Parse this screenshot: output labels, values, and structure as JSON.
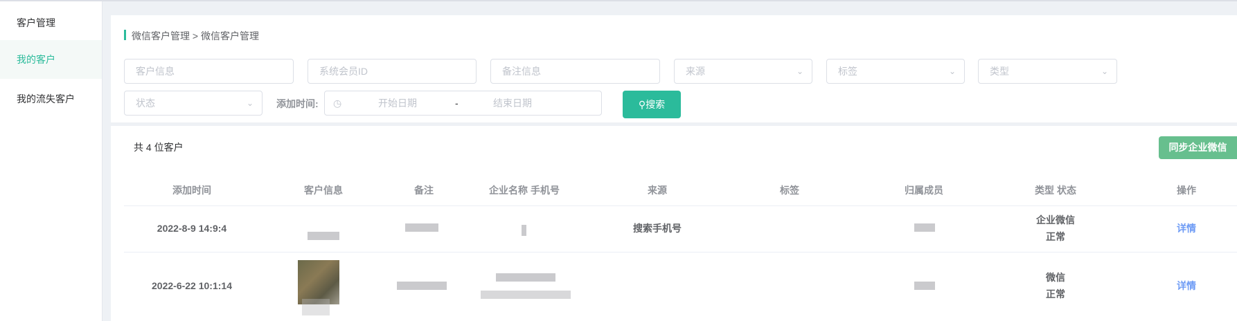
{
  "sidebar": {
    "items": [
      {
        "label": "客户管理"
      },
      {
        "label": "我的客户",
        "active": true
      },
      {
        "label": "我的流失客户"
      }
    ]
  },
  "breadcrumb": "微信客户管理 > 微信客户管理",
  "filters": {
    "customer_info": "客户信息",
    "member_id": "系统会员ID",
    "remark": "备注信息",
    "source": "来源",
    "tag": "标签",
    "type": "类型",
    "status": "状态",
    "add_time_label": "添加时间:",
    "start_date": "开始日期",
    "date_sep": "-",
    "end_date": "结束日期",
    "search_label": "搜索"
  },
  "summary": "共 4 位客户",
  "sync_label": "同步企业微信",
  "table": {
    "headers": [
      "添加时间",
      "客户信息",
      "备注",
      "企业名称 手机号",
      "来源",
      "标签",
      "归属成员",
      "类型 状态",
      "操作"
    ],
    "rows": [
      {
        "time": "2022-8-9 14:9:4",
        "source": "搜索手机号",
        "type": "企业微信",
        "status": "正常",
        "action": "详情"
      },
      {
        "time": "2022-6-22 10:1:14",
        "source": "",
        "type": "微信",
        "status": "正常",
        "action": "详情"
      }
    ]
  },
  "colors": {
    "accent": "#2bbb9b",
    "sync": "#67bf8e",
    "link": "#6f9cf5"
  }
}
